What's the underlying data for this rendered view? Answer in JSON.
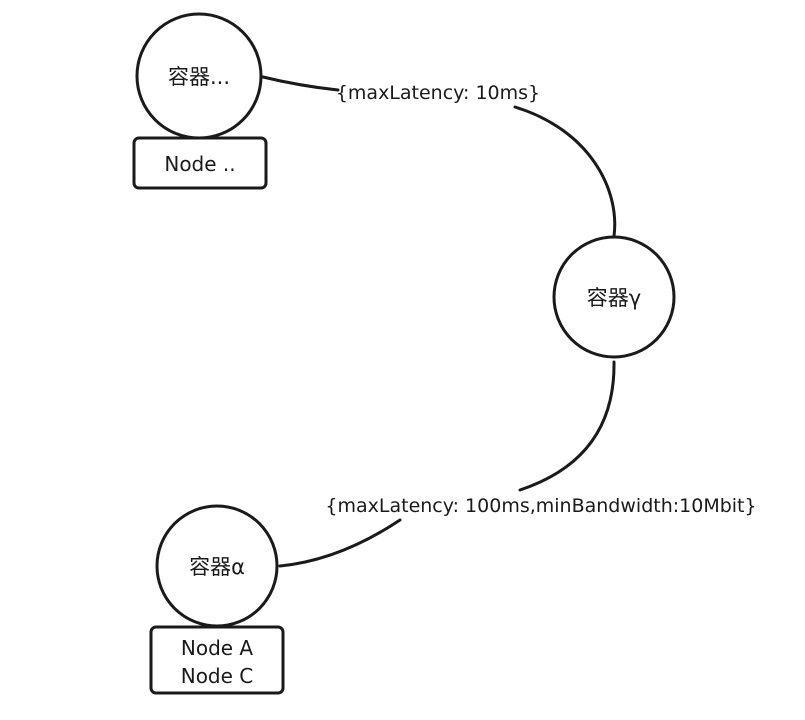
{
  "nodes": {
    "container_top": {
      "label": "容器...",
      "node_box": "Node .."
    },
    "container_gamma": {
      "label": "容器γ"
    },
    "container_alpha": {
      "label": "容器α",
      "node_box_lines": [
        "Node A",
        "Node C"
      ]
    }
  },
  "edges": {
    "top_to_gamma": {
      "label": "{maxLatency: 10ms}"
    },
    "alpha_to_gamma": {
      "label": "{maxLatency: 100ms,minBandwidth:10Mbit}"
    }
  },
  "colors": {
    "stroke": "#1a1a1a",
    "background": "#ffffff"
  }
}
